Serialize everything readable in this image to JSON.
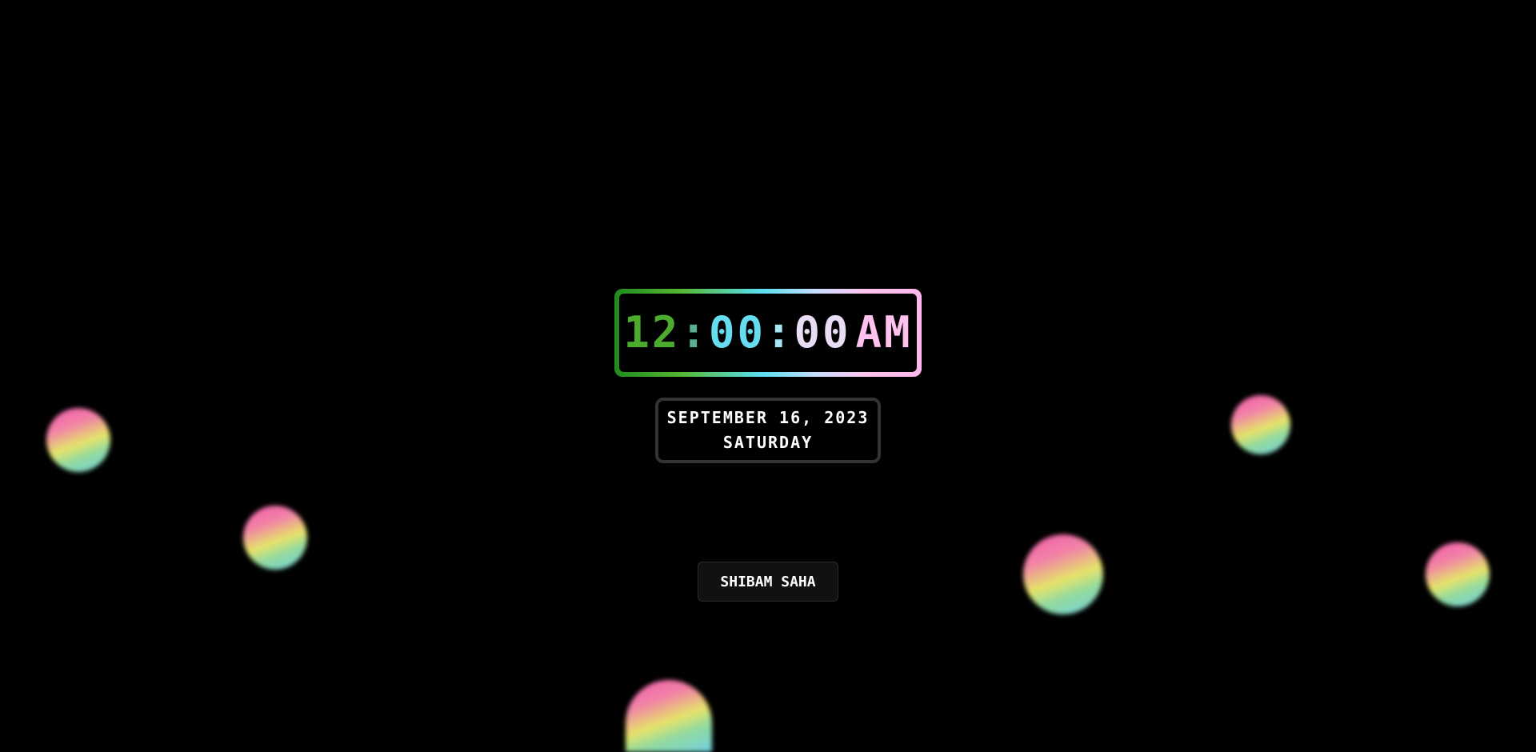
{
  "clock": {
    "hours": "12",
    "separator": ":",
    "minutes": "00",
    "seconds": "00",
    "period": "AM"
  },
  "date": {
    "full_date": "SEPTEMBER 16, 2023",
    "weekday": "SATURDAY"
  },
  "author": {
    "name": "SHIBAM SAHA"
  },
  "colors": {
    "background": "#000000",
    "border_start": "#1f8a1f",
    "border_mid": "#59dff2",
    "border_end": "#ffb6ea",
    "orb_pink": "#ff5fb4",
    "orb_yellow": "#f2f070",
    "orb_cyan": "#78dcee"
  }
}
